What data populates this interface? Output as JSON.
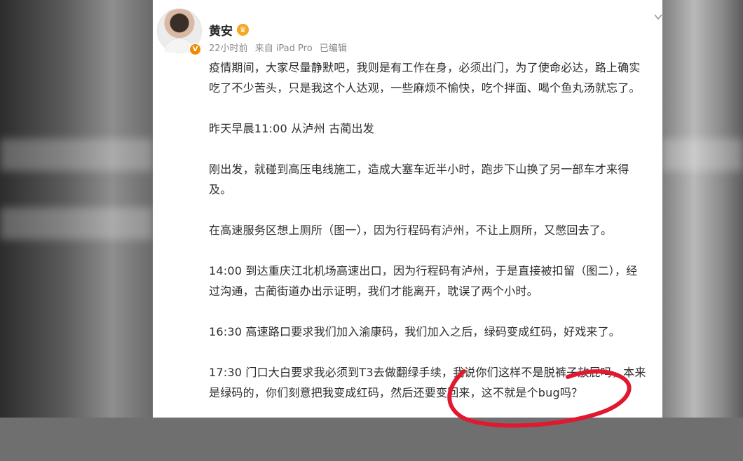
{
  "post": {
    "author": "黄安",
    "time": "22小时前",
    "source": "来自 iPad Pro",
    "edited": "已编辑",
    "lines": [
      "疫情期间，大家尽量静默吧，我则是有工作在身，必须出门，为了使命必达，路上确实",
      "吃了不少苦头，只是我这个人达观，一些麻烦不愉快，吃个拌面、喝个鱼丸汤就忘了。",
      "",
      "昨天早晨11:00 从泸州 古蔺出发",
      "",
      "刚出发，就碰到高压电线施工，造成大塞车近半小时，跑步下山换了另一部车才来得",
      "及。",
      "",
      "在高速服务区想上厕所（图一），因为行程码有泸州，不让上厕所，又憋回去了。",
      "",
      "14:00 到达重庆江北机场高速出口，因为行程码有泸州，于是直接被扣留（图二），经",
      "过沟通，古蔺街道办出示证明，我们才能离开，耽误了两个小时。",
      "",
      "16:30 高速路口要求我们加入渝康码，我们加入之后，绿码变成红码，好戏来了。",
      "",
      "17:30 门口大白要求我必须到T3去做翻绿手续，我说你们这样不是脱裤子放屁吗，本来",
      "是绿码的，你们刻意把我变成红码，然后还要变回来，这不就是个bug吗？"
    ]
  },
  "colors": {
    "annotation": "#e0192f",
    "badge": "#f08a00"
  },
  "icons": [
    "avatar",
    "verified-v-icon",
    "crown-badge-icon",
    "chevron-down-icon"
  ]
}
